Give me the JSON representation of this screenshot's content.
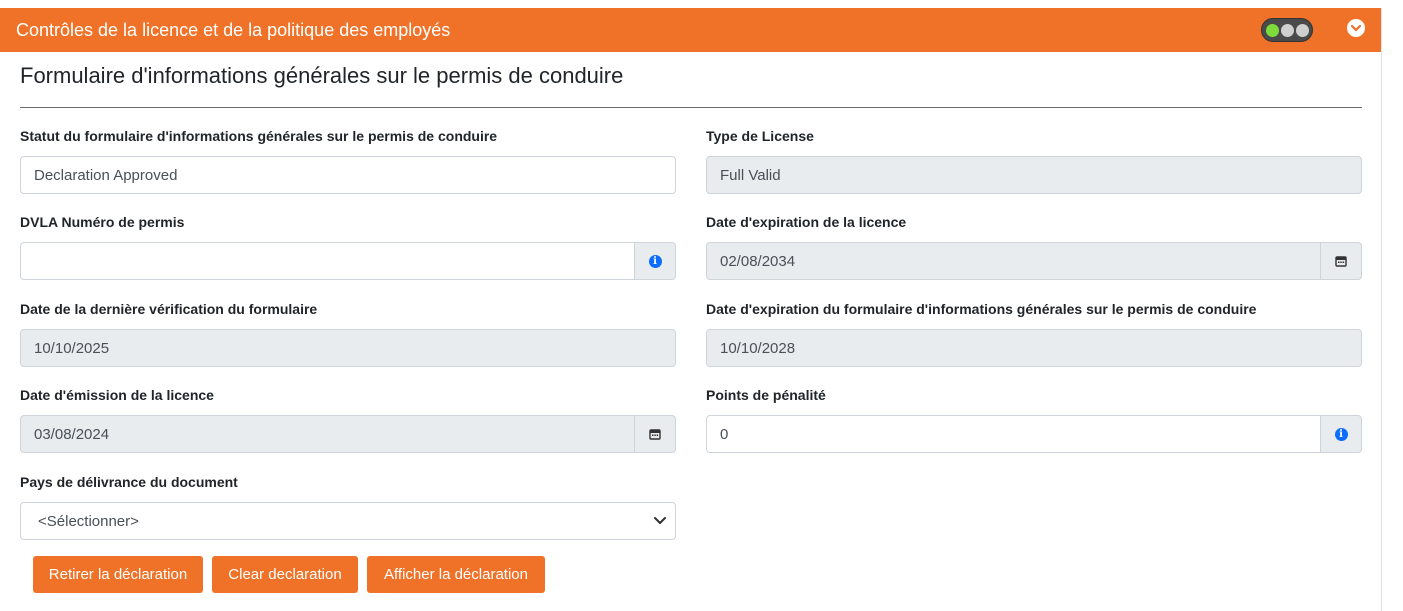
{
  "panel": {
    "title": "Contrôles de la licence et de la politique des employés",
    "icons": {
      "status": "traffic-light-icon",
      "collapse": "chevron-down-icon"
    }
  },
  "section": {
    "title": "Formulaire d'informations générales sur le permis de conduire"
  },
  "fields": {
    "form_status": {
      "label": "Statut du formulaire d'informations générales sur le permis de conduire",
      "value": "Declaration Approved"
    },
    "license_type": {
      "label": "Type de License",
      "value": "Full Valid"
    },
    "dvla_number": {
      "label": "DVLA Numéro de permis",
      "value": ""
    },
    "license_expiry": {
      "label": "Date d'expiration de la licence",
      "value": "02/08/2034"
    },
    "last_check": {
      "label": "Date de la dernière vérification du formulaire",
      "value": "10/10/2025"
    },
    "form_expiry": {
      "label": "Date d'expiration du formulaire d'informations générales sur le permis de conduire",
      "value": "10/10/2028"
    },
    "issue_date": {
      "label": "Date d'émission de la licence",
      "value": "03/08/2024"
    },
    "penalty_points": {
      "label": "Points de pénalité",
      "value": "0"
    },
    "country": {
      "label": "Pays de délivrance du document",
      "value": "<Sélectionner>"
    }
  },
  "buttons": {
    "withdraw": "Retirer la déclaration",
    "clear": "Clear declaration",
    "show": "Afficher la déclaration"
  },
  "colors": {
    "accent": "#f07228",
    "readonly_bg": "#e9ecef",
    "info": "#0d6efd"
  }
}
